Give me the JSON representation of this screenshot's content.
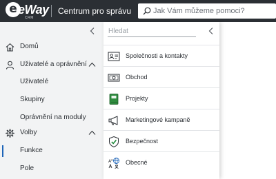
{
  "header": {
    "logo_text": "eWay",
    "logo_sub": "CRM",
    "app_title": "Centrum pro správu",
    "search": {
      "placeholder": "Jak Vám můžeme pomoci?",
      "value": ""
    }
  },
  "sidebar": {
    "items": [
      {
        "label": "Domů",
        "icon": "home-icon"
      },
      {
        "label": "Uživatelé a oprávnění",
        "icon": "user-icon",
        "expanded": true
      },
      {
        "label": "Uživatelé"
      },
      {
        "label": "Skupiny"
      },
      {
        "label": "Oprávnění na moduly"
      },
      {
        "label": "Volby",
        "icon": "gear-icon",
        "expanded": true
      },
      {
        "label": "Funkce",
        "active": true
      },
      {
        "label": "Pole"
      }
    ]
  },
  "panel": {
    "filter": {
      "placeholder": "Hledat",
      "value": ""
    },
    "items": [
      {
        "label": "Společnosti a kontakty",
        "icon": "contact-card-icon"
      },
      {
        "label": "Obchod",
        "icon": "money-icon"
      },
      {
        "label": "Projekty",
        "icon": "project-book-icon"
      },
      {
        "label": "Marketingové kampaně",
        "icon": "megaphone-icon"
      },
      {
        "label": "Bezpečnost",
        "icon": "shield-check-icon"
      },
      {
        "label": "Obecné",
        "icon": "language-globe-icon"
      }
    ]
  },
  "colors": {
    "topbar": "#2b2f34",
    "sidebar_bg": "#f2f3f4",
    "accent": "#1d64b8",
    "shield_green": "#1f8a3b",
    "book_green": "#2e8b3e"
  }
}
